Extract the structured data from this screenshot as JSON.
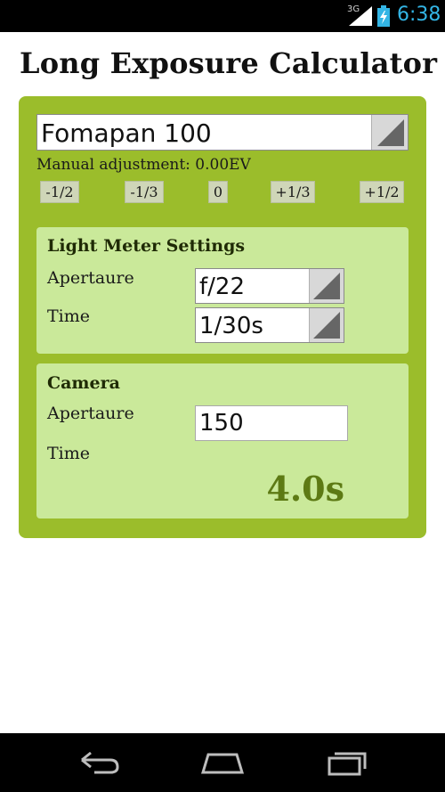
{
  "status_bar": {
    "network": "3G",
    "time": "6:38",
    "icons": [
      "signal-icon",
      "battery-charging-icon"
    ],
    "accent_color": "#33b5e5"
  },
  "app": {
    "title": "Long Exposure Calculator"
  },
  "film": {
    "selected": "Fomapan 100"
  },
  "adjustment": {
    "label": "Manual adjustment: 0.00EV",
    "buttons": [
      "-1/2",
      "-1/3",
      "0",
      "+1/3",
      "+1/2"
    ]
  },
  "light_meter": {
    "title": "Light Meter Settings",
    "aperture_label": "Apertaure",
    "aperture_value": "f/22",
    "time_label": "Time",
    "time_value": "1/30s"
  },
  "camera": {
    "title": "Camera",
    "aperture_label": "Apertaure",
    "aperture_value": "150",
    "time_label": "Time",
    "time_result": "4.0s"
  },
  "nav": {
    "icons": [
      "back-icon",
      "home-icon",
      "recent-apps-icon"
    ]
  },
  "colors": {
    "panel": "#9bbd2b",
    "sub_panel": "#cae99a",
    "result_text": "#5d7a14"
  }
}
